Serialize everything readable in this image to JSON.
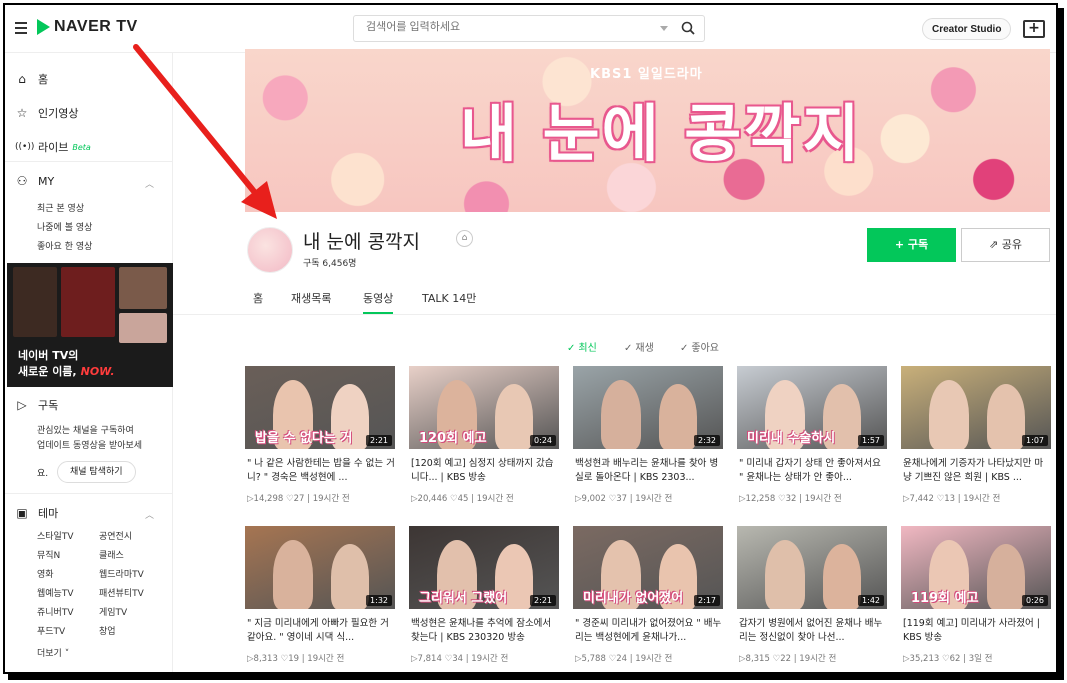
{
  "header": {
    "logo_text": "NAVER TV",
    "search_placeholder": "검색어를 입력하세요",
    "creator_studio": "Creator Studio"
  },
  "sidebar": {
    "home": "홈",
    "popular": "인기영상",
    "live": "라이브",
    "beta": "Beta",
    "my": "MY",
    "my_items": [
      "최근 본 영상",
      "나중에 볼 영상",
      "좋아요 한 영상"
    ],
    "promo": {
      "line1": "네이버 TV의",
      "line2": "새로운 이름,",
      "now": "NOW."
    },
    "subscribe": "구독",
    "subscribe_desc": [
      "관심있는 채널을 구독하여",
      "업데이트 동영상을 받아보세"
    ],
    "subscribe_yo": "요.",
    "explore_channels": "채널 탐색하기",
    "theme": "테마",
    "theme_items": [
      "스타일TV",
      "공연전시",
      "뮤직N",
      "클래스",
      "영화",
      "웹드라마TV",
      "웹예능TV",
      "패션뷰티TV",
      "쥬니버TV",
      "게임TV",
      "푸드TV",
      "창업"
    ],
    "more": "더보기"
  },
  "channel": {
    "banner_kbs": "KBS1 일일드라마",
    "banner_title": "내 눈에 콩깍지",
    "name": "내 눈에 콩깍지",
    "subscribers": "구독 6,456명",
    "subscribe_button": "+ 구독",
    "share_button": "공유"
  },
  "tabs": [
    "홈",
    "재생목록",
    "동영상",
    "TALK 14만"
  ],
  "sort_options": [
    "최신",
    "재생",
    "좋아요"
  ],
  "videos": [
    {
      "caption": "밥을 수 없다는 거",
      "duration": "2:21",
      "title": "\" 나 같은 사람한테는 밥을 수 없는 거니? \" 경숙은 백성현에 ...",
      "views": "▷14,298",
      "likes": "♡27",
      "time": "19시간 전"
    },
    {
      "caption": "120회 예고",
      "duration": "0:24",
      "title": "[120회 예고] 심정지 상태까지 갔습니다... | KBS 방송",
      "views": "▷20,446",
      "likes": "♡45",
      "time": "19시간 전"
    },
    {
      "caption": "",
      "duration": "2:32",
      "title": "백성현과 배누리는 윤채나를 찾아 병실로 돌아온다 | KBS 2303...",
      "views": "▷9,002",
      "likes": "♡37",
      "time": "19시간 전"
    },
    {
      "caption": "미리내 수술하시",
      "duration": "1:57",
      "title": "\" 미리내 갑자기 상태 안 좋아져서요 \" 윤채나는 상태가 안 좋아...",
      "views": "▷12,258",
      "likes": "♡32",
      "time": "19시간 전"
    },
    {
      "caption": "",
      "duration": "1:07",
      "title": "윤채나에게 기증자가 나타났지만 마냥 기쁘진 않은 희원 | KBS ...",
      "views": "▷7,442",
      "likes": "♡13",
      "time": "19시간 전"
    },
    {
      "caption": "",
      "duration": "1:32",
      "title": "\" 지금 미리내에게 아빠가 필요한 거 같아요. \" 영이네 시댁 식...",
      "views": "▷8,313",
      "likes": "♡19",
      "time": "19시간 전"
    },
    {
      "caption": "그리워서 그랬어",
      "duration": "2:21",
      "title": "백성현은 윤채나를 추억에 잠소에서 찾는다 | KBS 230320 방송",
      "views": "▷7,814",
      "likes": "♡34",
      "time": "19시간 전"
    },
    {
      "caption": "미리내가 없어졌어",
      "duration": "2:17",
      "title": "\" 경준씨 미리내가 없어졌어요 \" 배누리는 백성현에게 윤채나가...",
      "views": "▷5,788",
      "likes": "♡24",
      "time": "19시간 전"
    },
    {
      "caption": "",
      "duration": "1:42",
      "title": "갑자기 병원에서 없어진 윤채나 배누리는 정신없이 찾아 나선...",
      "views": "▷8,315",
      "likes": "♡22",
      "time": "19시간 전"
    },
    {
      "caption": "119회 예고",
      "duration": "0:26",
      "title": "[119회 예고] 미리내가 사라졌어 | KBS 방송",
      "views": "▷35,213",
      "likes": "♡62",
      "time": "3일 전"
    }
  ],
  "colors": {
    "accent": "#03c75a",
    "arrow": "#e8201c"
  }
}
